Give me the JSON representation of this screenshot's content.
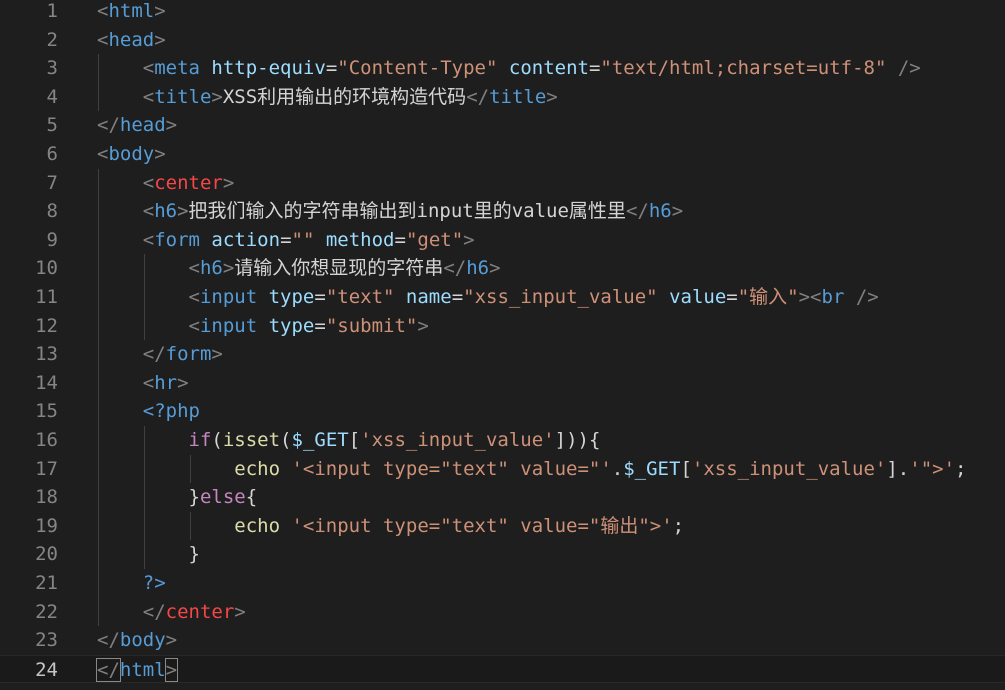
{
  "editor": {
    "language": "html",
    "current_line": 24,
    "colors": {
      "background": "#1e1e1e",
      "punctuation": "#808080",
      "tag": "#569cd6",
      "attribute": "#9cdcfe",
      "string": "#ce9178",
      "text": "#d4d4d4",
      "keyword": "#c586c0",
      "deprecated_tag": "#f44747",
      "line_number": "#858585"
    },
    "lines": [
      {
        "n": "1",
        "tokens": [
          [
            "punc",
            "<"
          ],
          [
            "tag",
            "html"
          ],
          [
            "punc",
            ">"
          ]
        ]
      },
      {
        "n": "2",
        "tokens": [
          [
            "punc",
            "<"
          ],
          [
            "tag",
            "head"
          ],
          [
            "punc",
            ">"
          ]
        ]
      },
      {
        "n": "3",
        "tokens": [
          [
            "punc",
            "    <"
          ],
          [
            "tag",
            "meta"
          ],
          [
            "text",
            " "
          ],
          [
            "attr",
            "http-equiv"
          ],
          [
            "text",
            "="
          ],
          [
            "str",
            "\"Content-Type\""
          ],
          [
            "text",
            " "
          ],
          [
            "attr",
            "content"
          ],
          [
            "text",
            "="
          ],
          [
            "str",
            "\"text/html;charset=utf-8\""
          ],
          [
            "text",
            " "
          ],
          [
            "punc",
            "/>"
          ]
        ]
      },
      {
        "n": "4",
        "tokens": [
          [
            "punc",
            "    <"
          ],
          [
            "tag",
            "title"
          ],
          [
            "punc",
            ">"
          ],
          [
            "text",
            "XSS利用输出的环境构造代码"
          ],
          [
            "punc",
            "</"
          ],
          [
            "tag",
            "title"
          ],
          [
            "punc",
            ">"
          ]
        ]
      },
      {
        "n": "5",
        "tokens": [
          [
            "punc",
            "</"
          ],
          [
            "tag",
            "head"
          ],
          [
            "punc",
            ">"
          ]
        ]
      },
      {
        "n": "6",
        "tokens": [
          [
            "punc",
            "<"
          ],
          [
            "tag",
            "body"
          ],
          [
            "punc",
            ">"
          ]
        ]
      },
      {
        "n": "7",
        "tokens": [
          [
            "punc",
            "    <"
          ],
          [
            "red",
            "center"
          ],
          [
            "punc",
            ">"
          ]
        ]
      },
      {
        "n": "8",
        "tokens": [
          [
            "punc",
            "    <"
          ],
          [
            "tag",
            "h6"
          ],
          [
            "punc",
            ">"
          ],
          [
            "text",
            "把我们输入的字符串输出到input里的value属性里"
          ],
          [
            "punc",
            "</"
          ],
          [
            "tag",
            "h6"
          ],
          [
            "punc",
            ">"
          ]
        ]
      },
      {
        "n": "9",
        "tokens": [
          [
            "punc",
            "    <"
          ],
          [
            "tag",
            "form"
          ],
          [
            "text",
            " "
          ],
          [
            "attr",
            "action"
          ],
          [
            "text",
            "="
          ],
          [
            "str",
            "\"\""
          ],
          [
            "text",
            " "
          ],
          [
            "attr",
            "method"
          ],
          [
            "text",
            "="
          ],
          [
            "str",
            "\"get\""
          ],
          [
            "punc",
            ">"
          ]
        ]
      },
      {
        "n": "10",
        "tokens": [
          [
            "punc",
            "        <"
          ],
          [
            "tag",
            "h6"
          ],
          [
            "punc",
            ">"
          ],
          [
            "text",
            "请输入你想显现的字符串"
          ],
          [
            "punc",
            "</"
          ],
          [
            "tag",
            "h6"
          ],
          [
            "punc",
            ">"
          ]
        ]
      },
      {
        "n": "11",
        "tokens": [
          [
            "punc",
            "        <"
          ],
          [
            "tag",
            "input"
          ],
          [
            "text",
            " "
          ],
          [
            "attr",
            "type"
          ],
          [
            "text",
            "="
          ],
          [
            "str",
            "\"text\""
          ],
          [
            "text",
            " "
          ],
          [
            "attr",
            "name"
          ],
          [
            "text",
            "="
          ],
          [
            "str",
            "\"xss_input_value\""
          ],
          [
            "text",
            " "
          ],
          [
            "attr",
            "value"
          ],
          [
            "text",
            "="
          ],
          [
            "str",
            "\"输入\""
          ],
          [
            "punc",
            "><"
          ],
          [
            "tag",
            "br"
          ],
          [
            "text",
            " "
          ],
          [
            "punc",
            "/>"
          ]
        ]
      },
      {
        "n": "12",
        "tokens": [
          [
            "punc",
            "        <"
          ],
          [
            "tag",
            "input"
          ],
          [
            "text",
            " "
          ],
          [
            "attr",
            "type"
          ],
          [
            "text",
            "="
          ],
          [
            "str",
            "\"submit\""
          ],
          [
            "punc",
            ">"
          ]
        ]
      },
      {
        "n": "13",
        "tokens": [
          [
            "punc",
            "    </"
          ],
          [
            "tag",
            "form"
          ],
          [
            "punc",
            ">"
          ]
        ]
      },
      {
        "n": "14",
        "tokens": [
          [
            "punc",
            "    <"
          ],
          [
            "tag",
            "hr"
          ],
          [
            "punc",
            ">"
          ]
        ]
      },
      {
        "n": "15",
        "tokens": [
          [
            "php",
            "    <?php"
          ]
        ]
      },
      {
        "n": "16",
        "tokens": [
          [
            "kw",
            "        if"
          ],
          [
            "text",
            "("
          ],
          [
            "fn",
            "isset"
          ],
          [
            "text",
            "("
          ],
          [
            "var",
            "$_GET"
          ],
          [
            "text",
            "["
          ],
          [
            "str",
            "'xss_input_value'"
          ],
          [
            "text",
            "])){"
          ]
        ]
      },
      {
        "n": "17",
        "tokens": [
          [
            "fn",
            "            echo"
          ],
          [
            "text",
            " "
          ],
          [
            "str",
            "'<input type=\"text\" value=\"'"
          ],
          [
            "text",
            "."
          ],
          [
            "var",
            "$_GET"
          ],
          [
            "text",
            "["
          ],
          [
            "str",
            "'xss_input_value'"
          ],
          [
            "text",
            "]."
          ],
          [
            "str",
            "'\">'"
          ],
          [
            "text",
            ";"
          ]
        ]
      },
      {
        "n": "18",
        "tokens": [
          [
            "text",
            "        }"
          ],
          [
            "kw",
            "else"
          ],
          [
            "text",
            "{"
          ]
        ]
      },
      {
        "n": "19",
        "tokens": [
          [
            "fn",
            "            echo"
          ],
          [
            "text",
            " "
          ],
          [
            "str",
            "'<input type=\"text\" value=\"输出\">'"
          ],
          [
            "text",
            ";"
          ]
        ]
      },
      {
        "n": "20",
        "tokens": [
          [
            "text",
            "        }"
          ]
        ]
      },
      {
        "n": "21",
        "tokens": [
          [
            "php",
            "    ?>"
          ]
        ]
      },
      {
        "n": "22",
        "tokens": [
          [
            "punc",
            "    </"
          ],
          [
            "red",
            "center"
          ],
          [
            "punc",
            ">"
          ]
        ]
      },
      {
        "n": "23",
        "tokens": [
          [
            "punc",
            "</"
          ],
          [
            "tag",
            "body"
          ],
          [
            "punc",
            ">"
          ]
        ]
      },
      {
        "n": "24",
        "tokens": [
          [
            "punc",
            "</"
          ],
          [
            "tag",
            "html"
          ],
          [
            "punc",
            ">"
          ]
        ]
      }
    ]
  }
}
